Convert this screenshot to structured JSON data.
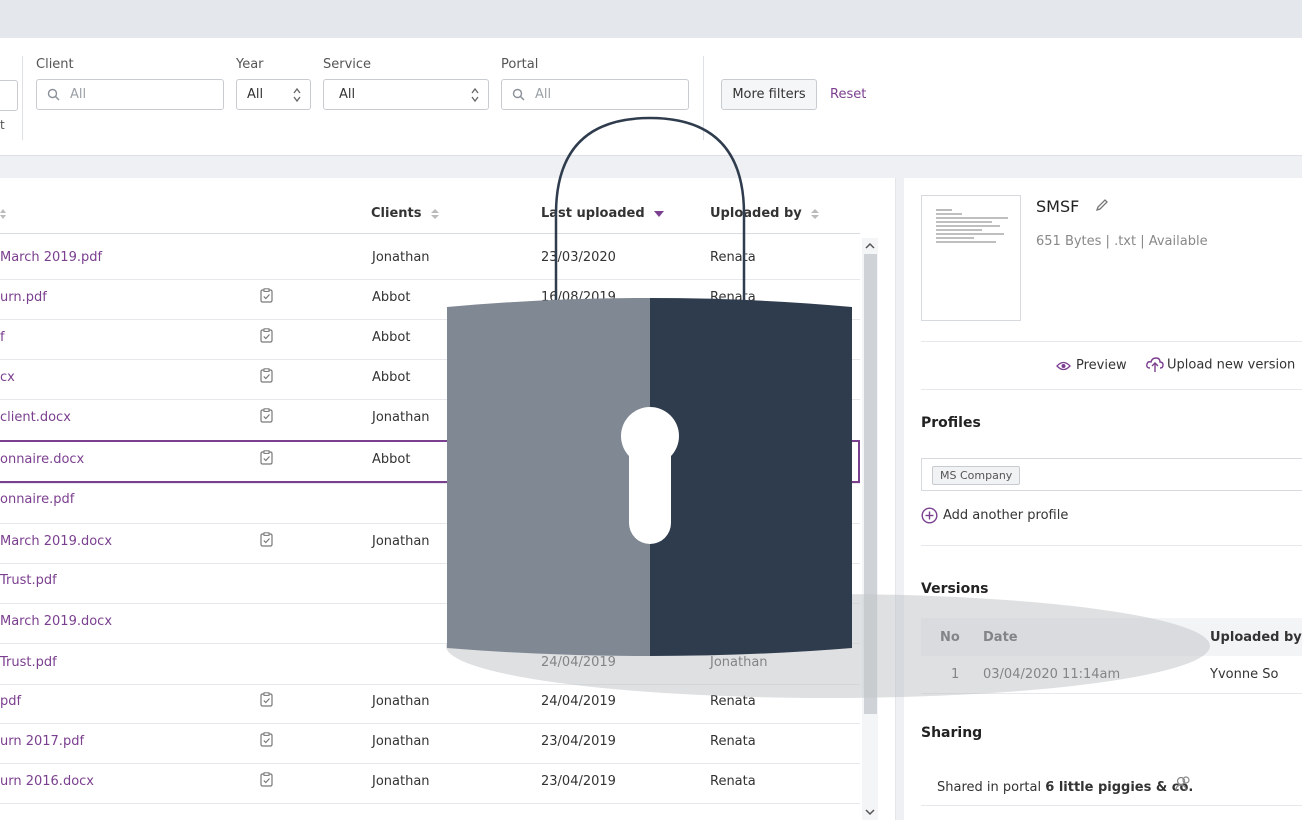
{
  "filters": {
    "client_label": "Client",
    "client_placeholder": "All",
    "year_label": "Year",
    "year_value": "All",
    "service_label": "Service",
    "service_value": "All",
    "portal_label": "Portal",
    "portal_placeholder": "All",
    "more_filters": "More filters",
    "reset": "Reset",
    "cut_text": "t"
  },
  "table": {
    "headers": {
      "clients": "Clients",
      "last_uploaded": "Last uploaded",
      "uploaded_by": "Uploaded by"
    },
    "rows": [
      {
        "name": "March 2019.pdf",
        "client": "Jonathan",
        "date": "23/03/2020",
        "by": "Renata",
        "clip": false
      },
      {
        "name": "urn.pdf",
        "client": "Abbot",
        "date": "16/08/2019",
        "by": "Renata",
        "clip": true
      },
      {
        "name": "f",
        "client": "Abbot",
        "date": "",
        "by": "",
        "clip": true
      },
      {
        "name": "cx",
        "client": "Abbot",
        "date": "",
        "by": "",
        "clip": true
      },
      {
        "name": "client.docx",
        "client": "Jonathan",
        "date": "",
        "by": "",
        "clip": true
      },
      {
        "name": "onnaire.docx",
        "client": "Abbot",
        "date": "",
        "by": "",
        "clip": true
      },
      {
        "name": "onnaire.pdf",
        "client": "",
        "date": "",
        "by": "",
        "clip": false
      },
      {
        "name": "March 2019.docx",
        "client": "Jonathan",
        "date": "",
        "by": "",
        "clip": true
      },
      {
        "name": "Trust.pdf",
        "client": "",
        "date": "",
        "by": "",
        "clip": false
      },
      {
        "name": "March 2019.docx",
        "client": "",
        "date": "",
        "by": "",
        "clip": false
      },
      {
        "name": "Trust.pdf",
        "client": "",
        "date": "24/04/2019",
        "by": "Jonathan",
        "clip": false
      },
      {
        "name": "pdf",
        "client": "Jonathan",
        "date": "24/04/2019",
        "by": "Renata",
        "clip": true
      },
      {
        "name": "urn 2017.pdf",
        "client": "Jonathan",
        "date": "23/04/2019",
        "by": "Renata",
        "clip": true
      },
      {
        "name": "urn 2016.docx",
        "client": "Jonathan",
        "date": "23/04/2019",
        "by": "Renata",
        "clip": true
      }
    ]
  },
  "detail": {
    "title": "SMSF",
    "meta": "651 Bytes | .txt | Available",
    "preview": "Preview",
    "upload_new": "Upload new version",
    "profiles_heading": "Profiles",
    "profile_tag": "MS Company",
    "add_profile": "Add another profile",
    "versions_heading": "Versions",
    "versions_cols": {
      "no": "No",
      "date": "Date",
      "by": "Uploaded by"
    },
    "versions_rows": [
      {
        "no": "1",
        "date": "03/04/2020 11:14am",
        "by": "Yvonne So"
      }
    ],
    "sharing_heading": "Sharing",
    "shared_prefix": "Shared in portal ",
    "shared_portal": "6 little piggies & co."
  },
  "colors": {
    "accent": "#7b3f8f",
    "lock_dark": "#2f3c4e",
    "lock_light": "#7f8893"
  }
}
